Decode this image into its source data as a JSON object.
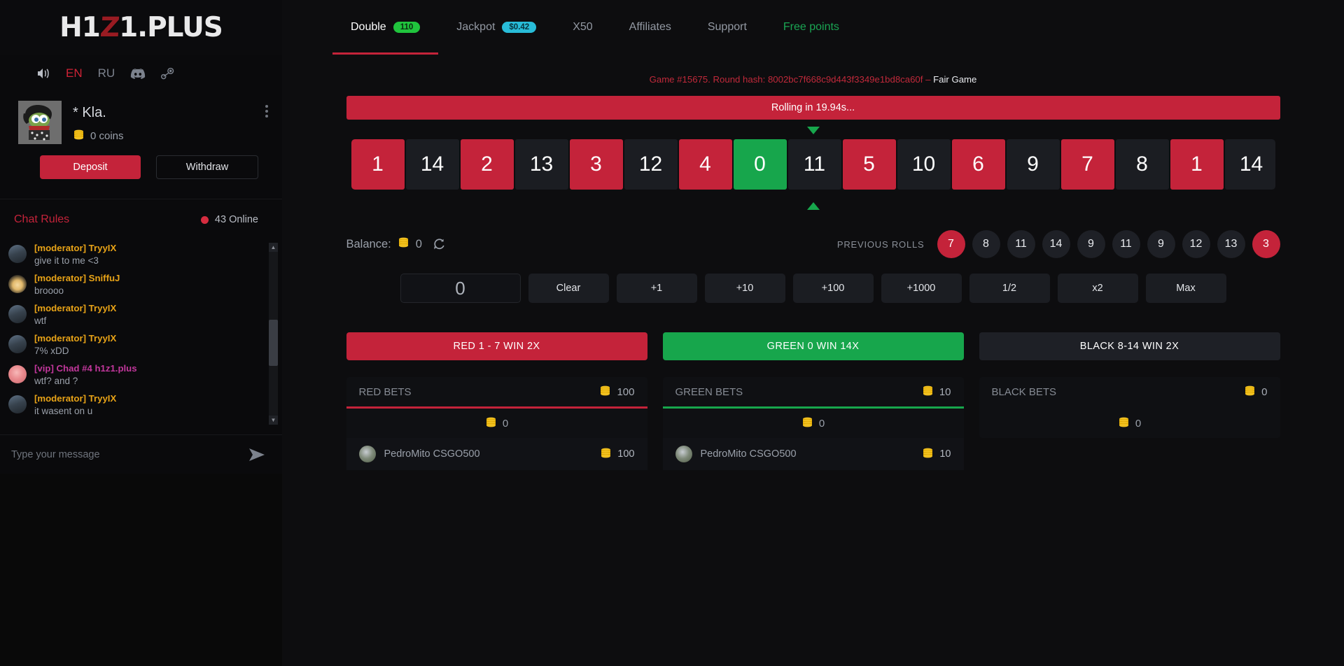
{
  "brand": {
    "name_part1": "H1",
    "name_z": "Z",
    "name_part2": "1.PLUS"
  },
  "sidebar": {
    "icons": {
      "sound": "speaker-icon",
      "discord": "discord-icon",
      "steam": "steam-icon"
    },
    "languages": [
      {
        "code": "EN",
        "active": true
      },
      {
        "code": "RU",
        "active": false
      }
    ],
    "profile": {
      "username": "* Kla.",
      "coins": "0 coins",
      "avatar": "pepe-avatar"
    },
    "deposit_label": "Deposit",
    "withdraw_label": "Withdraw",
    "chat_rules_label": "Chat Rules",
    "online_count": "43 Online",
    "messages": [
      {
        "name": "[moderator] TryyIX",
        "role": "mod",
        "avatar": "av-a",
        "text": "give it to me <3"
      },
      {
        "name": "[moderator] SniffuJ",
        "role": "mod",
        "avatar": "av-b",
        "text": "broooo"
      },
      {
        "name": "[moderator] TryyIX",
        "role": "mod",
        "avatar": "av-a",
        "text": "wtf"
      },
      {
        "name": "[moderator] TryyIX",
        "role": "mod",
        "avatar": "av-a",
        "text": "7% xDD"
      },
      {
        "name": "[vip] Chad #4 h1z1.plus",
        "role": "vip",
        "avatar": "av-c",
        "text": "wtf? and ?"
      },
      {
        "name": "[moderator] TryyIX",
        "role": "mod",
        "avatar": "av-a",
        "text": "it wasent on u"
      }
    ],
    "chat_placeholder": "Type your message"
  },
  "nav": {
    "tabs": [
      {
        "label": "Double",
        "badge": "110",
        "badge_color": "green",
        "active": true,
        "style": ""
      },
      {
        "label": "Jackpot",
        "badge": "$0.42",
        "badge_color": "cyan",
        "active": false,
        "style": ""
      },
      {
        "label": "X50",
        "badge": "",
        "badge_color": "",
        "active": false,
        "style": ""
      },
      {
        "label": "Affiliates",
        "badge": "",
        "badge_color": "",
        "active": false,
        "style": ""
      },
      {
        "label": "Support",
        "badge": "",
        "badge_color": "",
        "active": false,
        "style": ""
      },
      {
        "label": "Free points",
        "badge": "",
        "badge_color": "",
        "active": false,
        "style": "green"
      }
    ]
  },
  "game": {
    "info_text": "Game #15675. Round hash: 8002bc7f668c9d443f3349e1bd8ca60f – ",
    "fair_link": "Fair Game",
    "rolling_text": "Rolling in 19.94s...",
    "roller": [
      {
        "n": "1",
        "c": "red"
      },
      {
        "n": "14",
        "c": "black"
      },
      {
        "n": "2",
        "c": "red"
      },
      {
        "n": "13",
        "c": "black"
      },
      {
        "n": "3",
        "c": "red"
      },
      {
        "n": "12",
        "c": "black"
      },
      {
        "n": "4",
        "c": "red"
      },
      {
        "n": "0",
        "c": "green"
      },
      {
        "n": "11",
        "c": "black"
      },
      {
        "n": "5",
        "c": "red"
      },
      {
        "n": "10",
        "c": "black"
      },
      {
        "n": "6",
        "c": "red"
      },
      {
        "n": "9",
        "c": "black"
      },
      {
        "n": "7",
        "c": "red"
      },
      {
        "n": "8",
        "c": "black"
      },
      {
        "n": "1",
        "c": "red"
      },
      {
        "n": "14",
        "c": "black"
      },
      {
        "n": "",
        "c": "red"
      }
    ],
    "balance_label": "Balance:",
    "balance_value": "0",
    "previous_rolls_label": "PREVIOUS ROLLS",
    "previous_rolls": [
      {
        "n": "7",
        "c": "red"
      },
      {
        "n": "8",
        "c": "black"
      },
      {
        "n": "11",
        "c": "black"
      },
      {
        "n": "14",
        "c": "black"
      },
      {
        "n": "9",
        "c": "black"
      },
      {
        "n": "11",
        "c": "black"
      },
      {
        "n": "9",
        "c": "black"
      },
      {
        "n": "12",
        "c": "black"
      },
      {
        "n": "13",
        "c": "black"
      },
      {
        "n": "3",
        "c": "red"
      }
    ],
    "bet_amount": "0",
    "quick_buttons": [
      "Clear",
      "+1",
      "+10",
      "+100",
      "+1000",
      "1/2",
      "x2",
      "Max"
    ]
  },
  "panels": [
    {
      "head": "RED 1 - 7 WIN 2X",
      "color": "red",
      "bets_label": "RED BETS",
      "bets_total": "100",
      "my_total": "0",
      "items": [
        {
          "name": "PedroMito CSGO500",
          "amount": "100"
        }
      ]
    },
    {
      "head": "GREEN 0 WIN 14X",
      "color": "green",
      "bets_label": "GREEN BETS",
      "bets_total": "10",
      "my_total": "0",
      "items": [
        {
          "name": "PedroMito CSGO500",
          "amount": "10"
        }
      ]
    },
    {
      "head": "BLACK 8-14 WIN 2X",
      "color": "black",
      "bets_label": "BLACK BETS",
      "bets_total": "0",
      "my_total": "0",
      "items": []
    }
  ],
  "colors": {
    "red": "#c4233a",
    "green": "#17a64c",
    "black": "#1e2026",
    "badge_green": "#20c43d",
    "badge_cyan": "#28bcd8",
    "mod_name": "#e8a317",
    "vip_name": "#c2379c"
  }
}
